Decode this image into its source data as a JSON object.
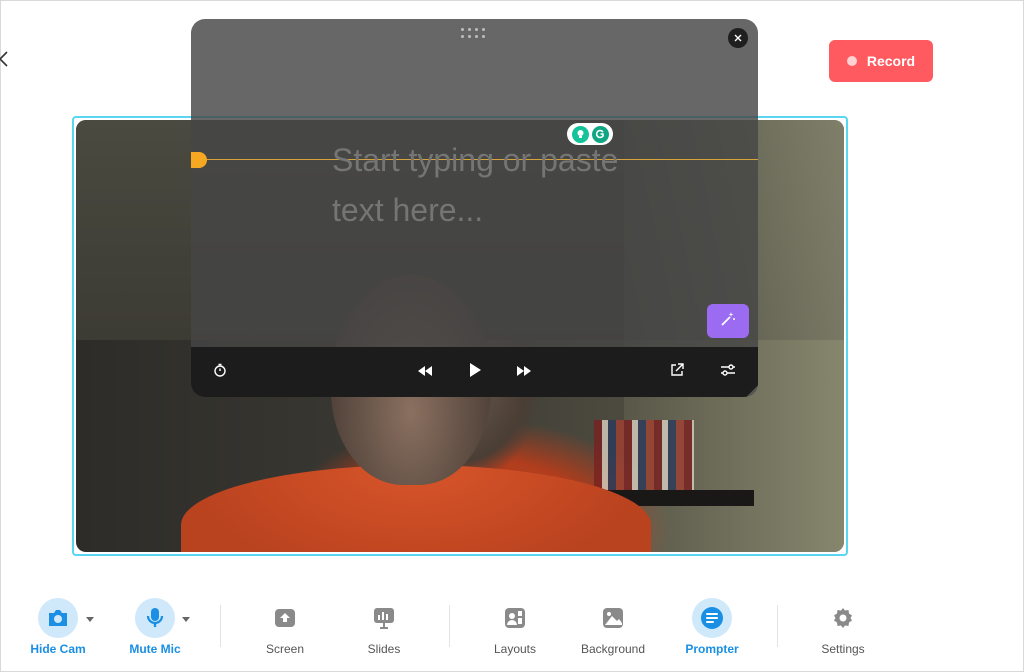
{
  "header": {
    "back_icon": "chevron-left-icon",
    "record_label": "Record"
  },
  "prompter": {
    "placeholder": "Start typing or paste text here...",
    "controls": {
      "timer_icon": "timer-icon",
      "rewind_icon": "rewind-icon",
      "play_icon": "play-icon",
      "forward_icon": "fast-forward-icon",
      "popout_icon": "external-link-icon",
      "settings_icon": "sliders-icon"
    },
    "magic_icon": "magic-wand-icon",
    "grammarly_icon": "grammarly-icon"
  },
  "toolbar": {
    "items": [
      {
        "label": "Hide Cam",
        "icon": "camera-icon",
        "active": true
      },
      {
        "label": "Mute Mic",
        "icon": "microphone-icon",
        "active": true
      },
      {
        "label": "Screen",
        "icon": "screen-share-icon",
        "active": false
      },
      {
        "label": "Slides",
        "icon": "slides-icon",
        "active": false
      },
      {
        "label": "Layouts",
        "icon": "layouts-icon",
        "active": false
      },
      {
        "label": "Background",
        "icon": "image-icon",
        "active": false
      },
      {
        "label": "Prompter",
        "icon": "prompter-icon",
        "active": true
      },
      {
        "label": "Settings",
        "icon": "gear-icon",
        "active": false
      }
    ]
  },
  "colors": {
    "record": "#ff5a5f",
    "accent": "#1a8fe3",
    "frame": "#5ad6f3",
    "guide": "#f7a823",
    "magic": "#9b6cf2"
  }
}
